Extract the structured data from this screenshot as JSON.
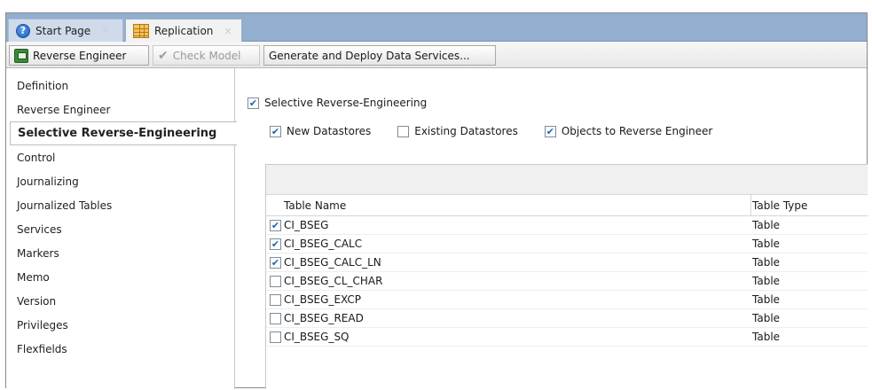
{
  "tabs": [
    {
      "label": "Start Page",
      "icon": "help-icon"
    },
    {
      "label": "Replication",
      "icon": "table-icon"
    }
  ],
  "toolbar": {
    "reverse_engineer": "Reverse Engineer",
    "check_model": "Check Model",
    "generate_deploy": "Generate and Deploy Data Services..."
  },
  "sidebar": {
    "items": [
      {
        "label": "Definition"
      },
      {
        "label": "Reverse Engineer"
      },
      {
        "label": "Selective Reverse-Engineering"
      },
      {
        "label": "Control"
      },
      {
        "label": "Journalizing"
      },
      {
        "label": "Journalized Tables"
      },
      {
        "label": "Services"
      },
      {
        "label": "Markers"
      },
      {
        "label": "Memo"
      },
      {
        "label": "Version"
      },
      {
        "label": "Privileges"
      },
      {
        "label": "Flexfields"
      }
    ],
    "selected_index": 2
  },
  "main": {
    "selective_label": "Selective Reverse-Engineering",
    "selective_checked": true,
    "options": [
      {
        "label": "New Datastores",
        "checked": true
      },
      {
        "label": "Existing Datastores",
        "checked": false
      },
      {
        "label": "Objects to Reverse Engineer",
        "checked": true
      }
    ],
    "table": {
      "columns": [
        "Table Name",
        "Table Type"
      ],
      "rows": [
        {
          "name": "CI_BSEG",
          "type": "Table",
          "checked": true
        },
        {
          "name": "CI_BSEG_CALC",
          "type": "Table",
          "checked": true
        },
        {
          "name": "CI_BSEG_CALC_LN",
          "type": "Table",
          "checked": true
        },
        {
          "name": "CI_BSEG_CL_CHAR",
          "type": "Table",
          "checked": false
        },
        {
          "name": "CI_BSEG_EXCP",
          "type": "Table",
          "checked": false
        },
        {
          "name": "CI_BSEG_READ",
          "type": "Table",
          "checked": false
        },
        {
          "name": "CI_BSEG_SQ",
          "type": "Table",
          "checked": false
        }
      ]
    }
  },
  "colors": {
    "tabbar_bg": "#92afd0",
    "checkmark": "#1e62b8"
  }
}
